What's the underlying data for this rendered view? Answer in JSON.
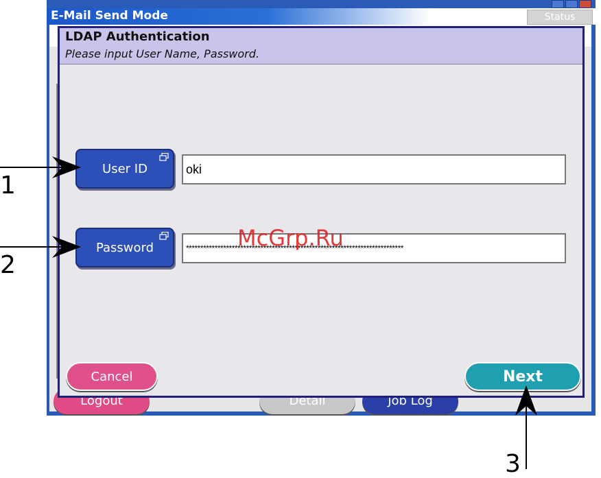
{
  "background_window": {
    "title": "E-Mail Send Mode",
    "status_label": "Status",
    "logout_label": "Logout",
    "detail_label": "Detail",
    "job_log_label": "Job Log"
  },
  "dialog": {
    "title": "LDAP Authentication",
    "subtitle": "Please input User Name, Password.",
    "user_id_label": "User ID",
    "user_id_value": "oki",
    "password_label": "Password",
    "password_value": "****************************************************************************",
    "cancel_label": "Cancel",
    "next_label": "Next"
  },
  "watermark": "McGrp.Ru",
  "callouts": [
    "1",
    "2",
    "3"
  ],
  "colors": {
    "header_band": "#c9c5ea",
    "field_button": "#2c4fb8",
    "cancel": "#e0508a",
    "next": "#1f9fb0",
    "watermark": "#e01818"
  }
}
